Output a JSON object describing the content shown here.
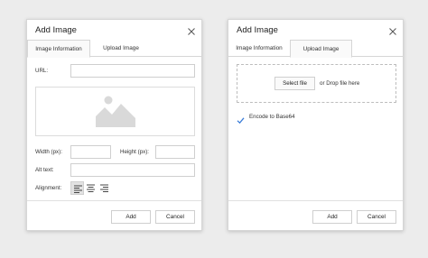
{
  "left_dialog": {
    "title": "Add Image",
    "tabs": [
      {
        "label": "Image Information",
        "active": true
      },
      {
        "label": "Upload Image",
        "active": false
      }
    ],
    "url_label": "URL:",
    "url_value": "",
    "width_label": "Width (px):",
    "width_value": "",
    "height_label": "Height (px):",
    "height_value": "",
    "alt_label": "Alt text:",
    "alt_value": "",
    "alignment_label": "Alignment:",
    "alignment_options": [
      "align-left",
      "align-center",
      "align-right"
    ],
    "alignment_selected": "align-left",
    "add_label": "Add",
    "cancel_label": "Cancel"
  },
  "right_dialog": {
    "title": "Add Image",
    "tabs": [
      {
        "label": "Image Information",
        "active": false
      },
      {
        "label": "Upload Image",
        "active": true
      }
    ],
    "select_file_label": "Select file",
    "drop_text": "or Drop file here",
    "encode_label": "Encode to Base64",
    "encode_checked": true,
    "add_label": "Add",
    "cancel_label": "Cancel"
  },
  "colors": {
    "background": "#ececec",
    "dialog_bg": "#ffffff",
    "border": "#d6d6d6",
    "check_accent": "#3b7dd8",
    "placeholder_icon": "#d9d9d9"
  }
}
